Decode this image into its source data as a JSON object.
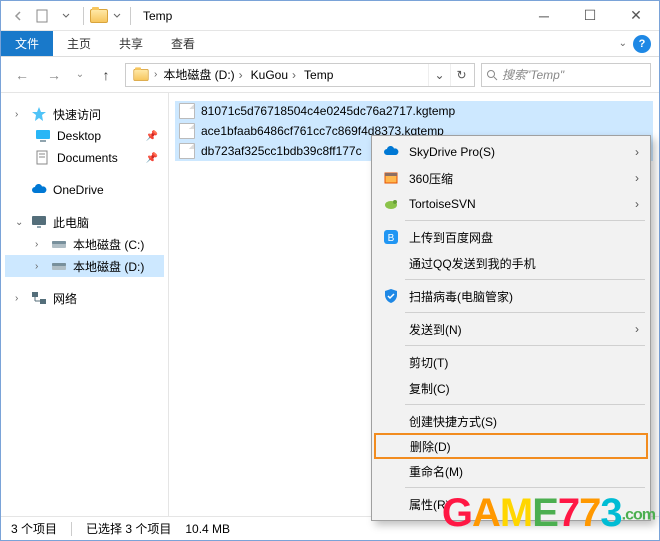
{
  "window": {
    "title": "Temp"
  },
  "ribbon": {
    "file": "文件",
    "tabs": [
      "主页",
      "共享",
      "查看"
    ]
  },
  "nav": {
    "crumbs": [
      "本地磁盘 (D:)",
      "KuGou",
      "Temp"
    ],
    "search_placeholder": "搜索\"Temp\""
  },
  "sidebar": {
    "quick": "快速访问",
    "desktop": "Desktop",
    "documents": "Documents",
    "onedrive": "OneDrive",
    "thispc": "此电脑",
    "drive_c": "本地磁盘 (C:)",
    "drive_d": "本地磁盘 (D:)",
    "network": "网络"
  },
  "files": [
    "81071c5d76718504c4e0245dc76a2717.kgtemp",
    "ace1bfaab6486cf761cc7c869f4d8373.kgtemp",
    "db723af325cc1bdb39c8ff177c"
  ],
  "ctx": {
    "skydrive": "SkyDrive Pro(S)",
    "zip360": "360压缩",
    "tortoise": "TortoiseSVN",
    "baidu": "上传到百度网盘",
    "qq": "通过QQ发送到我的手机",
    "scan": "扫描病毒(电脑管家)",
    "sendto": "发送到(N)",
    "cut": "剪切(T)",
    "copy": "复制(C)",
    "shortcut": "创建快捷方式(S)",
    "delete": "删除(D)",
    "rename": "重命名(M)",
    "props": "属性(R)"
  },
  "status": {
    "count": "3 个项目",
    "selected": "已选择 3 个项目",
    "size": "10.4 MB"
  },
  "watermark": {
    "text": "GAME773",
    "domain": ".com"
  }
}
